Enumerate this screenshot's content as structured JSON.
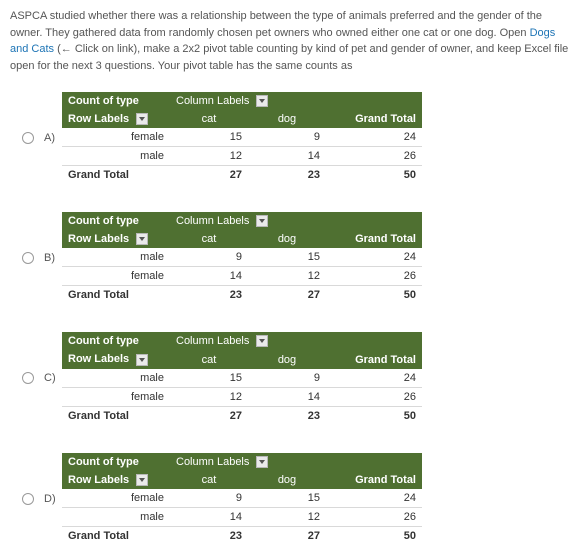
{
  "question": {
    "pre": "ASPCA studied whether there was a relationship between the type of animals preferred and the gender of the owner. They gathered data from randomly chosen pet owners who owned either one cat or one dog. Open ",
    "link_text": "Dogs and Cats",
    "post": " (← Click on link), make a 2x2 pivot table counting by kind of pet and gender of owner, and keep Excel file open for the next 3 questions. Your pivot table has the same counts as"
  },
  "headings": {
    "count_of_type": "Count of type",
    "column_labels": "Column Labels",
    "row_labels": "Row Labels",
    "cat": "cat",
    "dog": "dog",
    "grand_total": "Grand Total"
  },
  "options": [
    {
      "label": "A)",
      "rows": [
        {
          "label": "female",
          "cat": 15,
          "dog": 9,
          "total": 24
        },
        {
          "label": "male",
          "cat": 12,
          "dog": 14,
          "total": 26
        }
      ],
      "totals": {
        "cat": 27,
        "dog": 23,
        "total": 50
      }
    },
    {
      "label": "B)",
      "rows": [
        {
          "label": "male",
          "cat": 9,
          "dog": 15,
          "total": 24
        },
        {
          "label": "female",
          "cat": 14,
          "dog": 12,
          "total": 26
        }
      ],
      "totals": {
        "cat": 23,
        "dog": 27,
        "total": 50
      }
    },
    {
      "label": "C)",
      "rows": [
        {
          "label": "male",
          "cat": 15,
          "dog": 9,
          "total": 24
        },
        {
          "label": "female",
          "cat": 12,
          "dog": 14,
          "total": 26
        }
      ],
      "totals": {
        "cat": 27,
        "dog": 23,
        "total": 50
      }
    },
    {
      "label": "D)",
      "rows": [
        {
          "label": "female",
          "cat": 9,
          "dog": 15,
          "total": 24
        },
        {
          "label": "male",
          "cat": 14,
          "dog": 12,
          "total": 26
        }
      ],
      "totals": {
        "cat": 23,
        "dog": 27,
        "total": 50
      }
    }
  ]
}
